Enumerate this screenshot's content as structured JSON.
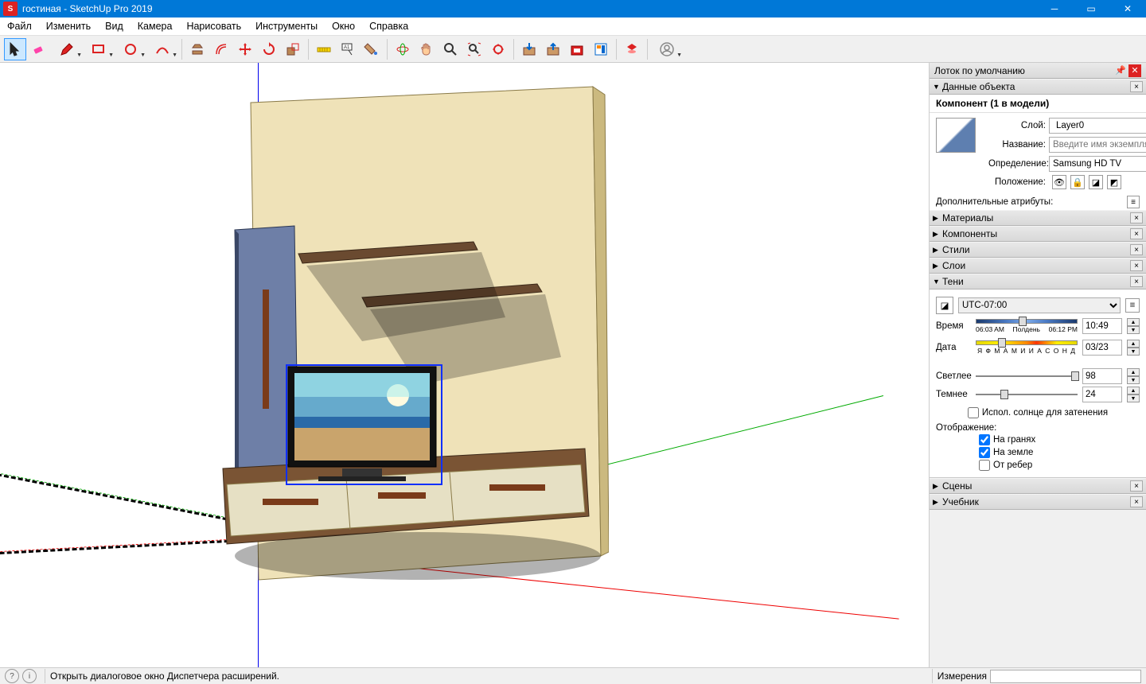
{
  "window": {
    "title": "гостиная - SketchUp Pro 2019"
  },
  "menu": [
    "Файл",
    "Изменить",
    "Вид",
    "Камера",
    "Нарисовать",
    "Инструменты",
    "Окно",
    "Справка"
  ],
  "toolbar_groups": [
    [
      "select",
      "eraser",
      "pencil",
      "rect",
      "circle",
      "arc"
    ],
    [
      "pushpull",
      "offset",
      "move",
      "rotate",
      "scale"
    ],
    [
      "tape",
      "text",
      "paint"
    ],
    [
      "orbit",
      "pan",
      "zoom",
      "zoom-extents",
      "zoom-window"
    ],
    [
      "warehouse-get",
      "warehouse-share",
      "ext-warehouse",
      "layout"
    ],
    [
      "ruby"
    ],
    [
      "account"
    ]
  ],
  "tray": {
    "title": "Лоток по умолчанию",
    "entity": {
      "header": "Данные объекта",
      "title": "Компонент (1 в модели)",
      "layer_label": "Слой:",
      "layer_value": "Layer0",
      "name_label": "Название:",
      "name_placeholder": "Введите имя экземпляра",
      "definition_label": "Определение:",
      "definition_value": "Samsung HD TV",
      "position_label": "Положение:",
      "advanced_label": "Дополнительные атрибуты:"
    },
    "panels_collapsed": [
      "Материалы",
      "Компоненты",
      "Стили",
      "Слои"
    ],
    "shadows": {
      "header": "Тени",
      "tz": "UTC-07:00",
      "time_label": "Время",
      "time_from": "06:03 AM",
      "time_noon": "Полдень",
      "time_to": "06:12 PM",
      "time_val": "10:49",
      "date_label": "Дата",
      "months": "Я Ф М А М И И А С О Н Д",
      "date_val": "03/23",
      "light_label": "Светлее",
      "light_val": "98",
      "dark_label": "Темнее",
      "dark_val": "24",
      "use_sun": "Испол. солнце для затенения",
      "display_label": "Отображение:",
      "on_faces": "На гранях",
      "on_ground": "На земле",
      "from_edges": "От ребер"
    },
    "panels_after": [
      "Сцены",
      "Учебник"
    ]
  },
  "status": {
    "hint": "Открыть диалоговое окно Диспетчера расширений.",
    "vcb_label": "Измерения"
  }
}
